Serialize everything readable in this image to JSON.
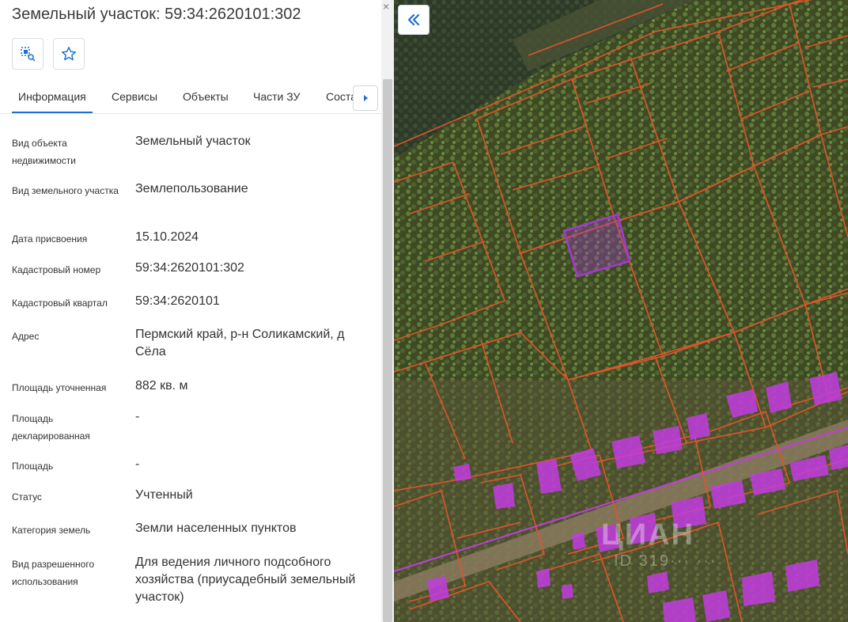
{
  "header": {
    "title": "Земельный участок: 59:34:2620101:302",
    "close_label": "×"
  },
  "toolbar": {
    "locate_icon": "locate-on-map-icon",
    "favorite_icon": "star-icon"
  },
  "tabs": [
    {
      "label": "Информация",
      "active": true
    },
    {
      "label": "Сервисы",
      "active": false
    },
    {
      "label": "Объекты",
      "active": false
    },
    {
      "label": "Части ЗУ",
      "active": false
    },
    {
      "label": "Состав",
      "active": false
    }
  ],
  "details": [
    {
      "label": "Вид объекта недвижимости",
      "value": "Земельный участок"
    },
    {
      "label": "Вид земельного участка",
      "value": "Землепользование"
    },
    {
      "label": "Дата присвоения",
      "value": "15.10.2024"
    },
    {
      "label": "Кадастровый номер",
      "value": "59:34:2620101:302"
    },
    {
      "label": "Кадастровый квартал",
      "value": "59:34:2620101"
    },
    {
      "label": "Адрес",
      "value": "Пермский край, р-н Соликамский, д Сёла"
    },
    {
      "label": "Площадь уточненная",
      "value": "882 кв. м"
    },
    {
      "label": "Площадь декларированная",
      "value": "-"
    },
    {
      "label": "Площадь",
      "value": "-"
    },
    {
      "label": "Статус",
      "value": "Учтенный"
    },
    {
      "label": "Категория земель",
      "value": "Земли населенных пунктов"
    },
    {
      "label": "Вид разрешенного использования",
      "value": "Для ведения личного подсобного хозяйства (приусадебный земельный участок)"
    }
  ],
  "map": {
    "watermark": "ЦИАН",
    "watermark_id": "ID 319··· ···"
  },
  "colors": {
    "accent": "#1e6fce",
    "parcel_border": "#e2542a",
    "selected_parcel": "#a23ad0",
    "building": "#c23ce0"
  }
}
